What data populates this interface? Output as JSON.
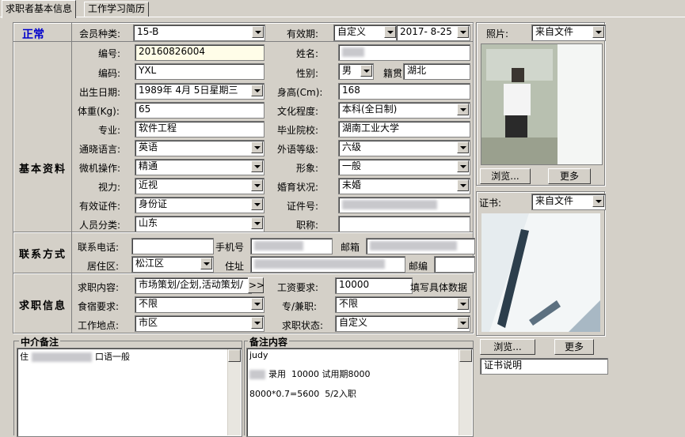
{
  "tabs": [
    "求职者基本信息",
    "工作学习简历"
  ],
  "status": "正常",
  "status_color": "#0000cc",
  "top": {
    "member_type_label": "会员种类:",
    "member_type": "15-B",
    "validity_label": "有效期:",
    "validity_mode": "自定义",
    "validity_date": "2017- 8-25"
  },
  "sections": {
    "basic": "基本资料",
    "contact": "联系方式",
    "job": "求职信息"
  },
  "basic": {
    "id_label": "编号:",
    "id": "20160826004",
    "name_label": "姓名:",
    "code_label": "编码:",
    "code": "YXL",
    "gender_label": "性别:",
    "gender": "男",
    "native_label": "籍贯",
    "native": "湖北",
    "birth_label": "出生日期:",
    "birth": "1989年 4月 5日星期三",
    "height_label": "身高(Cm):",
    "height": "168",
    "weight_label": "体重(Kg):",
    "weight": "65",
    "edu_label": "文化程度:",
    "edu": "本科(全日制)",
    "major_label": "专业:",
    "major": "软件工程",
    "school_label": "毕业院校:",
    "school": "湖南工业大学",
    "lang_label": "通晓语言:",
    "lang": "英语",
    "lang_level_label": "外语等级:",
    "lang_level": "六级",
    "computer_label": "微机操作:",
    "computer": "精通",
    "image_label": "形象:",
    "image": "一般",
    "vision_label": "视力:",
    "vision": "近视",
    "marital_label": "婚育状况:",
    "marital": "未婚",
    "idtype_label": "有效证件:",
    "idtype": "身份证",
    "idno_label": "证件号:",
    "category_label": "人员分类:",
    "category": "山东",
    "title_label": "职称:"
  },
  "contact": {
    "phone_label": "联系电话:",
    "mobile_label": "手机号",
    "email_label": "邮箱",
    "district_label": "居住区:",
    "district": "松江区",
    "address_label": "住址",
    "zip_label": "邮编"
  },
  "job": {
    "content_label": "求职内容:",
    "content": "市场策划/企划,活动策划/",
    "more_btn": ">>",
    "salary_label": "工资要求:",
    "salary": "10000",
    "salary_hint": "填写具体数据",
    "board_label": "食宿要求:",
    "board": "不限",
    "fulltime_label": "专/兼职:",
    "fulltime": "不限",
    "location_label": "工作地点:",
    "location": "市区",
    "jobstatus_label": "求职状态:",
    "jobstatus": "自定义"
  },
  "photo": {
    "label": "照片:",
    "source": "来自文件",
    "browse": "浏览...",
    "more": "更多"
  },
  "cert": {
    "label": "证书:",
    "source": "来自文件",
    "browse": "浏览...",
    "more": "更多",
    "desc": "证书说明"
  },
  "agency_notes": {
    "title": "中介备注",
    "line1_prefix": "住",
    "line1_suffix": "口语一般"
  },
  "remarks": {
    "title": "备注内容",
    "line1": "judy",
    "line2_suffix": "录用  10000 试用期8000",
    "line3": "8000*0.7=5600  5/2入职"
  }
}
